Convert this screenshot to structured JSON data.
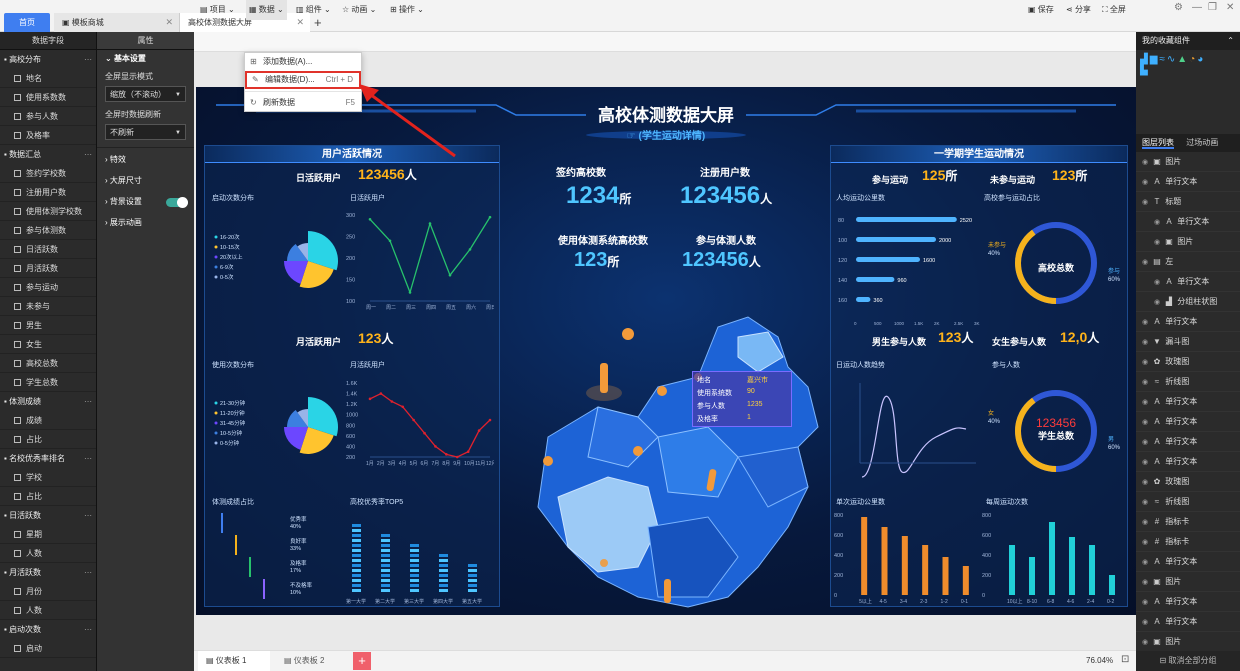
{
  "tabs": {
    "home": "首页",
    "template": "模板商城",
    "screen": "高校体测数据大屏"
  },
  "left": {
    "field_header": "数据字段",
    "prop_header": "属性",
    "groups": [
      {
        "name": "高校分布",
        "fields": [
          "地名",
          "使用系数数",
          "参与人数",
          "及格率"
        ]
      },
      {
        "name": "数据汇总",
        "fields": [
          "签约学校数",
          "注册用户数",
          "使用体测学校数",
          "参与体测数",
          "日活跃数",
          "月活跃数",
          "参与运动",
          "未参与",
          "男生",
          "女生",
          "高校总数",
          "学生总数"
        ]
      },
      {
        "name": "体测成绩",
        "fields": [
          "成绩",
          "占比"
        ]
      },
      {
        "name": "名校优秀率排名",
        "fields": [
          "学校",
          "占比"
        ]
      },
      {
        "name": "日活跃数",
        "fields": [
          "星期",
          "人数"
        ]
      },
      {
        "name": "月活跃数",
        "fields": [
          "月份",
          "人数"
        ]
      },
      {
        "name": "启动次数",
        "fields": [
          "启动"
        ]
      }
    ],
    "props": {
      "basic": "基本设置",
      "display_mode": "全屏显示模式",
      "display_value": "缩放（不滚动）",
      "refresh": "全屏时数据刷新",
      "refresh_value": "不刷新",
      "effects": "特效",
      "size": "大屏尺寸",
      "bg": "背景设置",
      "anim": "展示动画"
    }
  },
  "toolbar": {
    "project": "项目",
    "data": "数据",
    "component": "组件",
    "animation": "动画",
    "operation": "操作",
    "save": "保存",
    "share": "分享",
    "fullscreen": "全屏"
  },
  "dropdown": {
    "add": "添加数据(A)...",
    "edit": "编辑数据(D)...",
    "edit_key": "Ctrl + D",
    "refresh": "刷新数据",
    "refresh_key": "F5"
  },
  "dash": {
    "title": "高校体测数据大屏",
    "subtitle": "(学生运动详情)",
    "user_panel": "用户活跃情况",
    "daily_label": "日活跃用户",
    "daily_value": "123456",
    "person": "人",
    "monthly_label": "月活跃用户",
    "monthly_value": "123",
    "launch": "启动次数分布",
    "daily_chart": "日活跃用户",
    "usage": "使用次数分布",
    "monthly_chart": "月活跃用户",
    "grade": "体测成绩占比",
    "top5": "高校优秀率TOP5",
    "signed_label": "签约高校数",
    "signed_value": "1234",
    "unit_suo": "所",
    "reg_label": "注册用户数",
    "reg_value": "123456",
    "use_label": "使用体测系统高校数",
    "use_value": "123",
    "join_label": "参与体测人数",
    "join_value": "123456",
    "right_panel": "一学期学生运动情况",
    "part_label": "参与运动",
    "part_value": "125",
    "nopart_label": "未参与运动",
    "nopart_value": "123",
    "avg_km": "人均运动公里数",
    "ratio": "高校参与运动占比",
    "male_label": "男生参与人数",
    "male_value": "123",
    "female_label": "女生参与人数",
    "female_value": "12,0",
    "trend": "日运动人数趋势",
    "join_people": "参与人数",
    "single": "单次运动公里数",
    "weekly": "每周运动次数",
    "gauge1_center": "高校总数",
    "gauge2_center": "学生总数",
    "gauge2_num": "123456",
    "g1_left": "未参与",
    "g1_left_pct": "40%",
    "g1_right": "参与",
    "g1_right_pct": "60%",
    "g2_left": "女",
    "g2_left_pct": "40%",
    "g2_right": "男",
    "g2_right_pct": "60%",
    "tooltip": {
      "k1": "地名",
      "v1": "嘉兴市",
      "k2": "使用系统数",
      "v2": "90",
      "k3": "参与人数",
      "v3": "1235",
      "k4": "及格率",
      "v4": "1"
    }
  },
  "chart_data": [
    {
      "type": "line",
      "title": "日活跃用户",
      "categories": [
        "周一",
        "周二",
        "周三",
        "周四",
        "周五",
        "周六",
        "周日"
      ],
      "values": [
        290,
        240,
        120,
        280,
        160,
        220,
        295
      ],
      "ylim": [
        100,
        300
      ],
      "yticks": [
        "300",
        "250",
        "200",
        "150",
        "100"
      ],
      "color": "#27c26c"
    },
    {
      "type": "line",
      "title": "月活跃用户",
      "categories": [
        "1月",
        "2月",
        "3月",
        "4月",
        "5月",
        "6月",
        "7月",
        "8月",
        "9月",
        "10月",
        "11月",
        "12月"
      ],
      "values": [
        1300,
        1400,
        1250,
        1150,
        900,
        650,
        400,
        250,
        200,
        300,
        700,
        900
      ],
      "ylim": [
        200,
        1600
      ],
      "yticks": [
        "1.6K",
        "1.4K",
        "1.2K",
        "1000",
        "800",
        "600",
        "400",
        "200"
      ],
      "color": "#e0212d"
    },
    {
      "type": "bar",
      "title": "人均运动公里数",
      "categories": [
        "80",
        "100",
        "120",
        "140",
        "160"
      ],
      "values": [
        2520,
        2000,
        1600,
        960,
        360
      ],
      "xticks": [
        "0",
        "500",
        "1000",
        "1.5K",
        "2K",
        "2.5K",
        "3K"
      ]
    },
    {
      "type": "bar",
      "title": "单次运动公里数",
      "categories": [
        "5以上",
        "4-5",
        "3-4",
        "2-3",
        "1-2",
        "0-1"
      ],
      "values": [
        780,
        680,
        590,
        500,
        380,
        290
      ],
      "ylim": [
        0,
        800
      ],
      "yticks": [
        "800",
        "600",
        "400",
        "200",
        "0"
      ],
      "color": "#f08c2c"
    },
    {
      "type": "bar",
      "title": "每周运动次数",
      "categories": [
        "10以上",
        "8-10",
        "6-8",
        "4-6",
        "2-4",
        "0-2"
      ],
      "values": [
        500,
        380,
        730,
        580,
        500,
        200
      ],
      "ylim": [
        0,
        800
      ],
      "yticks": [
        "800",
        "600",
        "400",
        "200",
        "0"
      ],
      "color": "#21d0d8"
    },
    {
      "type": "pie",
      "title": "启动次数分布",
      "categories": [
        "16-20次",
        "10-15次",
        "20次以上",
        "6-9次",
        "0-5次"
      ],
      "values": [
        30,
        25,
        20,
        15,
        10
      ],
      "colors": [
        "#2ad4e6",
        "#ffc42e",
        "#6c47ff",
        "#3c7fe0",
        "#99b4e8"
      ]
    },
    {
      "type": "pie",
      "title": "使用次数分布",
      "categories": [
        "21-30分钟",
        "11-20分钟",
        "31-45分钟",
        "10-5分钟",
        "0-5分钟"
      ],
      "values": [
        30,
        25,
        20,
        15,
        10
      ],
      "colors": [
        "#2ad4e6",
        "#ffc42e",
        "#6c47ff",
        "#3c7fe0",
        "#99b4e8"
      ]
    },
    {
      "type": "bar",
      "title": "体测成绩占比",
      "categories": [
        "优秀率",
        "良好率",
        "及格率",
        "不及格率"
      ],
      "values": [
        40,
        33,
        17,
        10
      ],
      "labels": [
        "40%",
        "33%",
        "17%",
        "10%"
      ]
    },
    {
      "type": "bar",
      "title": "高校优秀率TOP5",
      "categories": [
        "第一大学",
        "第二大学",
        "第三大学",
        "第四大学",
        "第五大学"
      ],
      "values": [
        14,
        12,
        10,
        8,
        6
      ]
    }
  ],
  "right": {
    "fav_header": "我的收藏组件",
    "layers_tab": "图层列表",
    "anim_tab": "过场动画",
    "layers": [
      "图片",
      "单行文本",
      "标题",
      "单行文本",
      "图片",
      "左",
      "单行文本",
      "分组柱状图",
      "单行文本",
      "漏斗图",
      "玫瑰图",
      "折线图",
      "单行文本",
      "单行文本",
      "单行文本",
      "单行文本",
      "玫瑰图",
      "折线图",
      "指标卡",
      "指标卡",
      "单行文本",
      "图片",
      "单行文本",
      "单行文本",
      "图片"
    ],
    "cancel_group": "取消全部分组"
  },
  "bottom": {
    "sheet1": "仪表板 1",
    "sheet2": "仪表板 2",
    "zoom": "76.04%"
  }
}
